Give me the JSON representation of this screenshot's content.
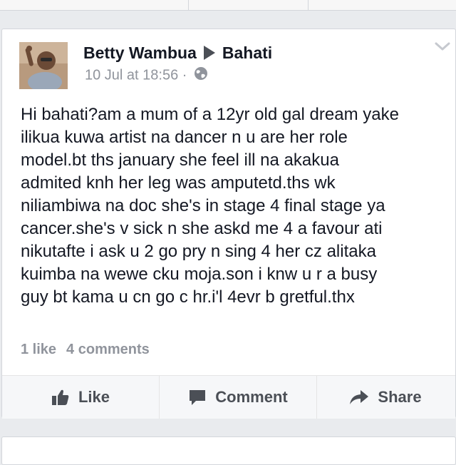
{
  "post": {
    "author": "Betty Wambua",
    "target": "Bahati",
    "timestamp": "10 Jul at 18:56",
    "separator": "·",
    "privacy_icon": "globe-icon",
    "text_lines": [
      "Hi bahati?am a mum of a 12yr old gal dream yake",
      "ilikua kuwa artist na dancer n u are her role",
      "model.bt ths january she feel ill na akakua",
      "admited knh her leg was amputetd.ths wk",
      "niliambiwa na doc she's in stage 4 final stage ya",
      "cancer.she's v sick n she askd me 4 a favour ati",
      "nikutafte i ask u 2 go pry n sing 4 her cz alitaka",
      "kuimba na wewe cku moja.son i knw u r a busy",
      "guy bt kama u cn go c hr.i'l 4evr b gretful.thx"
    ],
    "likes": "1 like",
    "comments": "4 comments"
  },
  "actions": {
    "like": "Like",
    "comment": "Comment",
    "share": "Share"
  },
  "colors": {
    "background": "#e9ebee",
    "text": "#141823",
    "meta": "#90949c",
    "action": "#4b4f56"
  }
}
